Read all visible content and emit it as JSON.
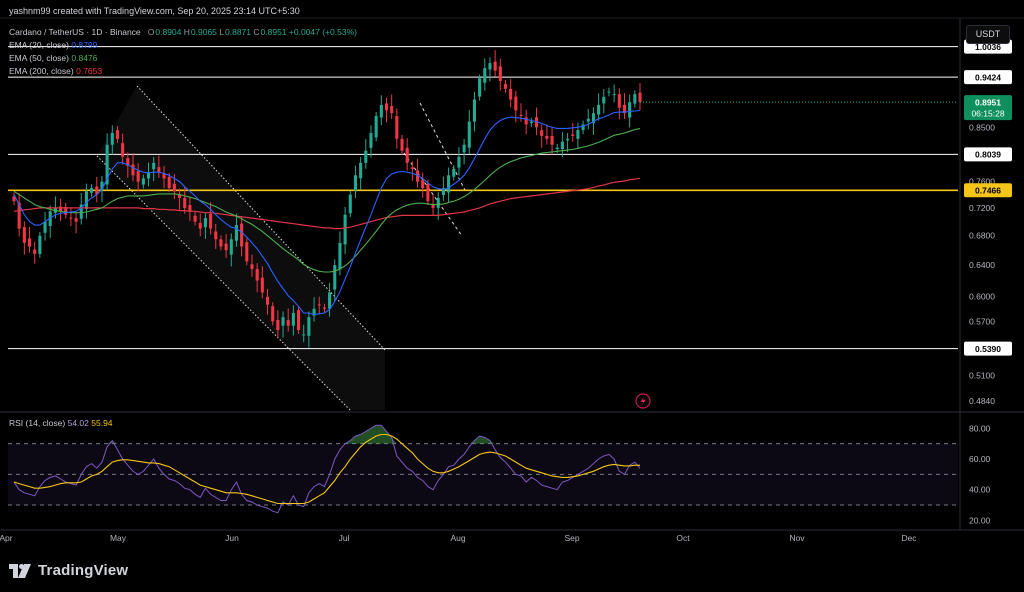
{
  "header": {
    "credit": "yashnm99 created with TradingView.com, Sep 20, 2025 23:14 UTC+5:30",
    "currency_button": "USDT"
  },
  "legend": {
    "symbol": "Cardano / TetherUS · 1D · Binance",
    "ohlc": {
      "o_label": "O",
      "o": "0.8904",
      "h_label": "H",
      "h": "0.9065",
      "l_label": "L",
      "l": "0.8871",
      "c_label": "C",
      "c": "0.8951",
      "change": "+0.0047 (+0.53%)"
    },
    "ema20_label": "EMA (20, close)",
    "ema20_value": "0.8799",
    "ema50_label": "EMA (50, close)",
    "ema50_value": "0.8476",
    "ema200_label": "EMA (200, close)",
    "ema200_value": "0.7653",
    "rsi_label": "RSI (14, close)",
    "rsi_value": "54.02",
    "rsi_ma_value": "55.94"
  },
  "footer": {
    "brand": "TradingView"
  },
  "colors": {
    "up": "#22ab94",
    "down": "#f23645",
    "ema20": "#2962ff",
    "ema50": "#4caf50",
    "ema200": "#e03545",
    "support_yellow": "#f5c518",
    "rsi_line": "#7e57c2",
    "rsi_ma": "#f5c518",
    "current_price_badge": "#0f8f5c"
  },
  "chart_data": [
    {
      "type": "candlestick",
      "title": "Cardano / TetherUS · 1D · Binance",
      "x_tick_labels": [
        "Apr",
        "May",
        "Jun",
        "Jul",
        "Aug",
        "Sep",
        "Oct",
        "Nov",
        "Dec"
      ],
      "y_scale": "log",
      "y_tick_labels": [
        "0.8500",
        "0.7600",
        "0.7200",
        "0.6800",
        "0.6400",
        "0.6000",
        "0.5700",
        "0.5100",
        "0.4840"
      ],
      "y_ticks": [
        0.85,
        0.76,
        0.72,
        0.68,
        0.64,
        0.6,
        0.57,
        0.51,
        0.484
      ],
      "ylim": [
        0.475,
        1.06
      ],
      "horizontal_levels": [
        {
          "label": "1.0036",
          "value": 1.0036,
          "color": "#ffffff"
        },
        {
          "label": "0.9424",
          "value": 0.9424,
          "color": "#ffffff"
        },
        {
          "label": "0.8039",
          "value": 0.8039,
          "color": "#ffffff"
        },
        {
          "label": "0.7466",
          "value": 0.7466,
          "color": "#f5c518"
        },
        {
          "label": "0.5390",
          "value": 0.539,
          "color": "#ffffff"
        }
      ],
      "current_price": {
        "value": 0.8951,
        "label": "0.8951",
        "countdown": "06:15:28"
      },
      "close_series": [
        0.73,
        0.69,
        0.67,
        0.665,
        0.655,
        0.68,
        0.7,
        0.715,
        0.72,
        0.715,
        0.71,
        0.705,
        0.7,
        0.725,
        0.745,
        0.75,
        0.74,
        0.76,
        0.82,
        0.84,
        0.83,
        0.8,
        0.785,
        0.77,
        0.76,
        0.765,
        0.775,
        0.79,
        0.775,
        0.765,
        0.75,
        0.745,
        0.735,
        0.72,
        0.715,
        0.7,
        0.69,
        0.705,
        0.69,
        0.675,
        0.665,
        0.66,
        0.675,
        0.695,
        0.665,
        0.645,
        0.635,
        0.62,
        0.605,
        0.59,
        0.57,
        0.56,
        0.575,
        0.565,
        0.58,
        0.56,
        0.555,
        0.575,
        0.585,
        0.59,
        0.585,
        0.605,
        0.64,
        0.67,
        0.71,
        0.74,
        0.77,
        0.79,
        0.81,
        0.84,
        0.87,
        0.89,
        0.88,
        0.875,
        0.83,
        0.81,
        0.79,
        0.78,
        0.76,
        0.75,
        0.73,
        0.72,
        0.735,
        0.75,
        0.77,
        0.78,
        0.8,
        0.82,
        0.86,
        0.9,
        0.94,
        0.96,
        0.97,
        0.955,
        0.935,
        0.92,
        0.9,
        0.88,
        0.87,
        0.855,
        0.86,
        0.85,
        0.835,
        0.83,
        0.82,
        0.815,
        0.825,
        0.83,
        0.835,
        0.845,
        0.855,
        0.865,
        0.875,
        0.89,
        0.905,
        0.915,
        0.91,
        0.885,
        0.875,
        0.895,
        0.91,
        0.8951
      ],
      "ema20": [
        0.74,
        0.725,
        0.71,
        0.7,
        0.695,
        0.695,
        0.7,
        0.705,
        0.71,
        0.712,
        0.713,
        0.714,
        0.715,
        0.72,
        0.728,
        0.735,
        0.74,
        0.748,
        0.765,
        0.78,
        0.79,
        0.79,
        0.787,
        0.782,
        0.778,
        0.775,
        0.774,
        0.775,
        0.775,
        0.773,
        0.77,
        0.765,
        0.76,
        0.752,
        0.745,
        0.738,
        0.73,
        0.725,
        0.718,
        0.71,
        0.703,
        0.697,
        0.692,
        0.69,
        0.685,
        0.678,
        0.67,
        0.662,
        0.652,
        0.642,
        0.63,
        0.619,
        0.61,
        0.601,
        0.595,
        0.588,
        0.58,
        0.58,
        0.578,
        0.579,
        0.58,
        0.584,
        0.594,
        0.606,
        0.622,
        0.638,
        0.656,
        0.674,
        0.692,
        0.71,
        0.73,
        0.75,
        0.765,
        0.772,
        0.775,
        0.776,
        0.775,
        0.773,
        0.77,
        0.765,
        0.758,
        0.752,
        0.749,
        0.748,
        0.75,
        0.756,
        0.762,
        0.77,
        0.782,
        0.797,
        0.813,
        0.83,
        0.845,
        0.855,
        0.862,
        0.866,
        0.868,
        0.867,
        0.866,
        0.864,
        0.862,
        0.86,
        0.857,
        0.853,
        0.85,
        0.848,
        0.848,
        0.848,
        0.849,
        0.85,
        0.852,
        0.855,
        0.86,
        0.865,
        0.868,
        0.872,
        0.876,
        0.877,
        0.877,
        0.878,
        0.879,
        0.8799
      ],
      "ema50": [
        0.745,
        0.74,
        0.735,
        0.73,
        0.725,
        0.722,
        0.72,
        0.718,
        0.716,
        0.715,
        0.714,
        0.713,
        0.713,
        0.713,
        0.714,
        0.716,
        0.718,
        0.72,
        0.725,
        0.73,
        0.734,
        0.736,
        0.738,
        0.738,
        0.738,
        0.738,
        0.739,
        0.74,
        0.741,
        0.741,
        0.741,
        0.741,
        0.74,
        0.738,
        0.736,
        0.734,
        0.731,
        0.728,
        0.725,
        0.722,
        0.718,
        0.714,
        0.711,
        0.708,
        0.704,
        0.7,
        0.696,
        0.691,
        0.686,
        0.68,
        0.674,
        0.668,
        0.662,
        0.657,
        0.652,
        0.647,
        0.641,
        0.637,
        0.634,
        0.632,
        0.631,
        0.631,
        0.632,
        0.635,
        0.639,
        0.645,
        0.652,
        0.66,
        0.668,
        0.677,
        0.686,
        0.696,
        0.705,
        0.712,
        0.717,
        0.721,
        0.724,
        0.726,
        0.727,
        0.727,
        0.726,
        0.725,
        0.725,
        0.726,
        0.728,
        0.73,
        0.733,
        0.737,
        0.742,
        0.748,
        0.755,
        0.762,
        0.77,
        0.777,
        0.783,
        0.788,
        0.792,
        0.795,
        0.798,
        0.8,
        0.802,
        0.804,
        0.806,
        0.807,
        0.808,
        0.809,
        0.81,
        0.811,
        0.812,
        0.814,
        0.816,
        0.818,
        0.821,
        0.824,
        0.828,
        0.832,
        0.836,
        0.838,
        0.84,
        0.843,
        0.846,
        0.8476
      ],
      "ema200": [
        0.715,
        0.716,
        0.717,
        0.718,
        0.719,
        0.72,
        0.72,
        0.72,
        0.72,
        0.72,
        0.72,
        0.72,
        0.72,
        0.72,
        0.72,
        0.72,
        0.72,
        0.72,
        0.72,
        0.72,
        0.72,
        0.72,
        0.72,
        0.72,
        0.72,
        0.719,
        0.719,
        0.719,
        0.718,
        0.718,
        0.717,
        0.717,
        0.716,
        0.716,
        0.715,
        0.715,
        0.714,
        0.713,
        0.713,
        0.712,
        0.711,
        0.71,
        0.709,
        0.708,
        0.707,
        0.706,
        0.705,
        0.704,
        0.703,
        0.702,
        0.701,
        0.7,
        0.699,
        0.698,
        0.697,
        0.696,
        0.695,
        0.694,
        0.693,
        0.692,
        0.691,
        0.691,
        0.69,
        0.69,
        0.691,
        0.692,
        0.694,
        0.696,
        0.698,
        0.7,
        0.702,
        0.704,
        0.706,
        0.707,
        0.708,
        0.709,
        0.709,
        0.709,
        0.709,
        0.709,
        0.709,
        0.709,
        0.709,
        0.71,
        0.711,
        0.712,
        0.713,
        0.714,
        0.716,
        0.718,
        0.72,
        0.723,
        0.726,
        0.728,
        0.73,
        0.732,
        0.734,
        0.735,
        0.736,
        0.737,
        0.738,
        0.739,
        0.74,
        0.741,
        0.742,
        0.743,
        0.744,
        0.745,
        0.746,
        0.747,
        0.748,
        0.749,
        0.751,
        0.753,
        0.755,
        0.757,
        0.759,
        0.76,
        0.761,
        0.763,
        0.764,
        0.7653
      ]
    },
    {
      "type": "line",
      "title": "RSI (14, close)",
      "y_tick_labels": [
        "80.00",
        "60.00",
        "40.00",
        "20.00"
      ],
      "y_ticks": [
        80,
        60,
        40,
        20
      ],
      "ylim": [
        17,
        90
      ],
      "bands": {
        "upper": 70,
        "middle": 50,
        "lower": 30
      },
      "series": [
        {
          "name": "RSI (14, close)",
          "current": 54.02,
          "values": [
            45,
            40,
            38,
            37,
            36,
            42,
            46,
            48,
            49,
            47,
            45,
            44,
            43,
            50,
            55,
            57,
            54,
            58,
            68,
            72,
            66,
            60,
            56,
            52,
            50,
            52,
            56,
            60,
            54,
            50,
            47,
            46,
            44,
            41,
            40,
            37,
            35,
            41,
            37,
            35,
            33,
            33,
            40,
            45,
            37,
            33,
            32,
            30,
            29,
            28,
            26,
            25,
            32,
            30,
            36,
            30,
            29,
            38,
            42,
            44,
            42,
            50,
            60,
            66,
            70,
            72,
            75,
            76,
            78,
            80,
            82,
            82,
            78,
            74,
            62,
            58,
            54,
            52,
            48,
            46,
            42,
            40,
            46,
            50,
            55,
            56,
            60,
            63,
            68,
            72,
            75,
            74,
            72,
            66,
            61,
            58,
            54,
            50,
            49,
            45,
            48,
            46,
            43,
            42,
            41,
            40,
            45,
            46,
            48,
            50,
            52,
            54,
            57,
            60,
            62,
            63,
            60,
            52,
            50,
            56,
            58,
            54.02
          ]
        },
        {
          "name": "RSI-based MA",
          "current": 55.94,
          "values": [
            45,
            44,
            43,
            42,
            41,
            41,
            41.5,
            42,
            43,
            44,
            44.5,
            44.5,
            44.5,
            45,
            47,
            49,
            50,
            52,
            55,
            58,
            59,
            59.5,
            59.5,
            59,
            58.5,
            58,
            57.5,
            57.5,
            57,
            56,
            55,
            53,
            51,
            49,
            47,
            45,
            43,
            42,
            41,
            40,
            39,
            38,
            38,
            38,
            37.5,
            37,
            36,
            35,
            34,
            33,
            32,
            31,
            31,
            31,
            31,
            31,
            31,
            32,
            34,
            36,
            38,
            42,
            46,
            51,
            55,
            60,
            64,
            68,
            71,
            73,
            75,
            76,
            76,
            75,
            73,
            70,
            67,
            64,
            60,
            57,
            54,
            52,
            51,
            51,
            52,
            53.5,
            55,
            57,
            59,
            61,
            63,
            64,
            64.5,
            64,
            63,
            62,
            60,
            58,
            56,
            54,
            53,
            52,
            51,
            50,
            49,
            48.5,
            48,
            48,
            48.5,
            49,
            50,
            51,
            52,
            53.5,
            55,
            56,
            56.5,
            56,
            55.5,
            55.5,
            56,
            55.94
          ]
        }
      ]
    }
  ]
}
